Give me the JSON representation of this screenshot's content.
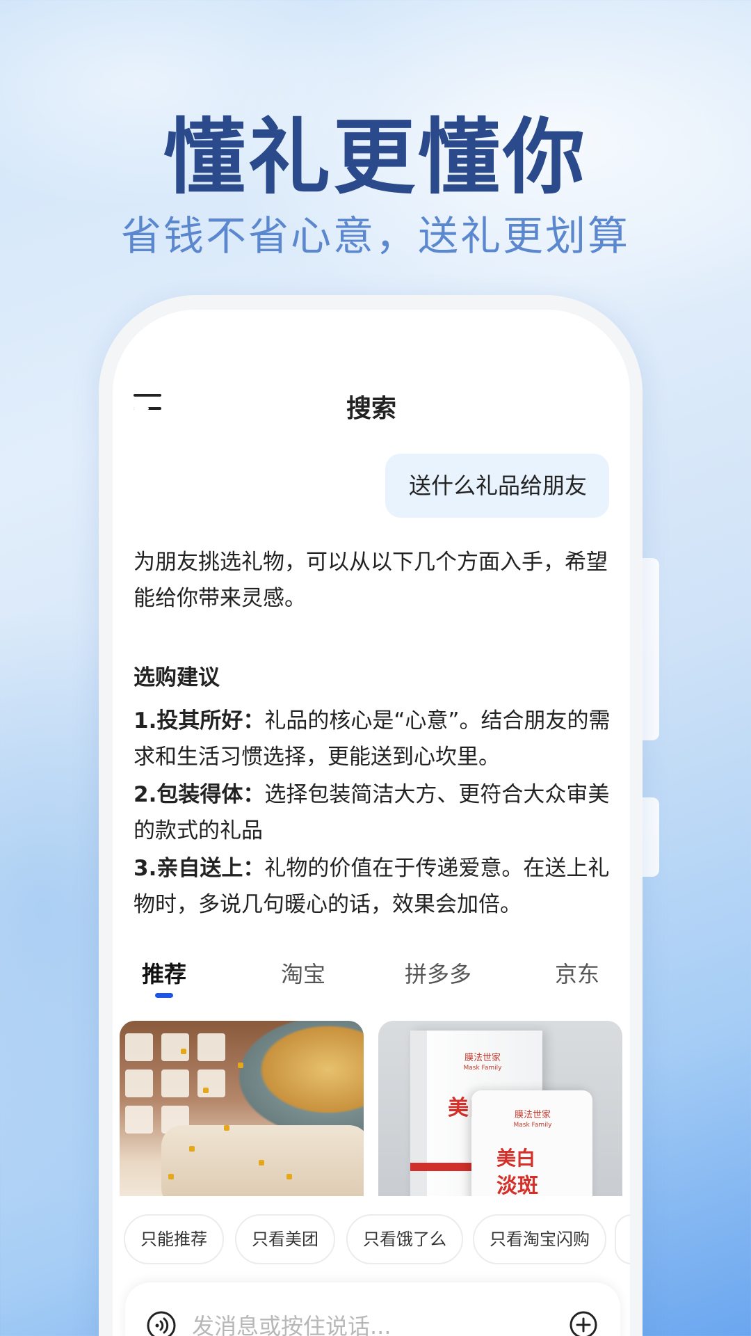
{
  "hero": {
    "title": "懂礼更懂你",
    "subtitle": "省钱不省心意，送礼更划算"
  },
  "header": {
    "title": "搜索",
    "menu_icon": "menu-icon"
  },
  "chat": {
    "user_message": "送什么礼品给朋友",
    "reply_intro": "为朋友挑选礼物，可以从以下几个方面入手，希望能给你带来灵感。",
    "section_title": "选购建议",
    "tips": [
      {
        "label": "1.投其所好：",
        "text": "礼品的核心是“心意”。结合朋友的需求和生活习惯选择，更能送到心坎里。"
      },
      {
        "label": "2.包装得体：",
        "text": "选择包装简洁大方、更符合大众审美的款式的礼品"
      },
      {
        "label": "3.亲自送上：",
        "text": "礼物的价值在于传递爱意。在送上礼物时，多说几句暖心的话，效果会加倍。"
      }
    ]
  },
  "tabs": [
    {
      "label": "推荐",
      "active": true
    },
    {
      "label": "淘宝",
      "active": false
    },
    {
      "label": "拼多多",
      "active": false
    },
    {
      "label": "京东",
      "active": false
    }
  ],
  "products": {
    "mask_brand": "膜法世家",
    "mask_brand_en": "Mask Family",
    "mask_text_1": "美白",
    "mask_text_2": "淡斑"
  },
  "chips": [
    "只能推荐",
    "只看美团",
    "只看饿了么",
    "只看淘宝闪购"
  ],
  "input": {
    "placeholder": "发消息或按住说话...",
    "voice_icon": "voice-icon",
    "add_icon": "plus-circle-icon"
  },
  "colors": {
    "hero_title": "#2b4a8c",
    "hero_subtitle": "#5b87cf",
    "tab_indicator": "#1d56e6",
    "user_bubble": "#e9f3fd"
  }
}
